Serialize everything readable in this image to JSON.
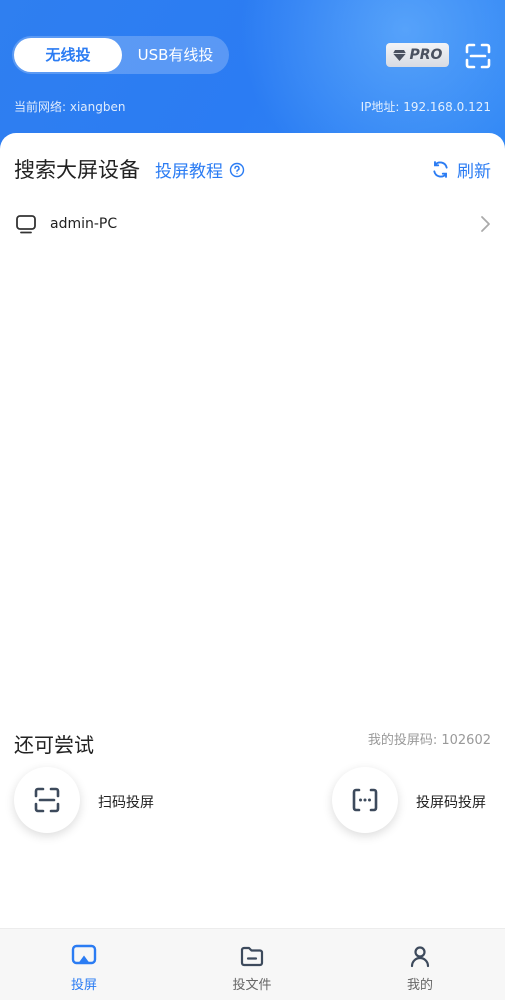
{
  "header": {
    "mode_tabs": [
      {
        "label": "无线投",
        "active": true
      },
      {
        "label": "USB有线投",
        "active": false
      }
    ],
    "pro_badge": "PRO",
    "network_label": "当前网络: xiangben",
    "ip_label": "IP地址: 192.168.0.121"
  },
  "devices_section": {
    "title": "搜索大屏设备",
    "tutorial_link": "投屏教程",
    "refresh_label": "刷新",
    "devices": [
      {
        "name": "admin-PC"
      }
    ]
  },
  "try_section": {
    "title": "还可尝试",
    "cast_code_label": "我的投屏码: ",
    "cast_code": "102602",
    "options": [
      {
        "label": "扫码投屏",
        "icon": "scan-icon"
      },
      {
        "label": "投屏码投屏",
        "icon": "code-input-icon"
      }
    ]
  },
  "bottom_nav": [
    {
      "label": "投屏",
      "icon": "cast-icon",
      "active": true
    },
    {
      "label": "投文件",
      "icon": "folder-icon",
      "active": false
    },
    {
      "label": "我的",
      "icon": "person-icon",
      "active": false
    }
  ],
  "colors": {
    "accent": "#2b7cf3",
    "header_bg": "#2f7ff0",
    "icon_dark": "#3d4a5c"
  }
}
